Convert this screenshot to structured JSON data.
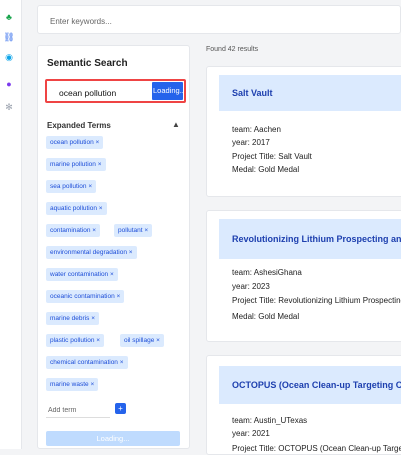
{
  "rail": {
    "icons": [
      "tree-icon",
      "link-icon",
      "globe-icon",
      "settings-icon"
    ]
  },
  "search": {
    "placeholder": "Enter keywords..."
  },
  "panel": {
    "title": "Semantic Search",
    "query": "ocean pollution",
    "go_label": "Loading...",
    "expanded_title": "Expanded Terms",
    "caret": "▲",
    "terms": [
      "ocean pollution",
      "marine pollution",
      "sea pollution",
      "aquatic pollution",
      "contamination",
      "pollutant",
      "environmental degradation",
      "water contamination",
      "oceanic contamination",
      "marine debris",
      "plastic pollution",
      "oil spillage",
      "chemical contamination",
      "marine waste"
    ],
    "remove_glyph": "×",
    "add_placeholder": "Add term",
    "add_label": "+",
    "loading_label": "Loading..."
  },
  "results": {
    "count_text": "Found 42 results",
    "items": [
      {
        "title": "Salt Vault",
        "team": "team:  Aachen",
        "year": "year:  2017",
        "project": "Project Title:  Salt Vault",
        "medal": "Medal:  Gold Medal"
      },
      {
        "title": "Revolutionizing Lithium Prospecting and",
        "team": "team:  AshesiGhana",
        "year": "year:  2023",
        "project": "Project Title:  Revolutionizing Lithium Prospecting",
        "medal": "Medal:  Gold Medal"
      },
      {
        "title": "OCTOPUS (Ocean Clean-up Targeting O",
        "team": "team:  Austin_UTexas",
        "year": "year:  2021",
        "project": "Project Title:  OCTOPUS (Ocean Clean-up Targeting",
        "medal": ""
      }
    ]
  }
}
